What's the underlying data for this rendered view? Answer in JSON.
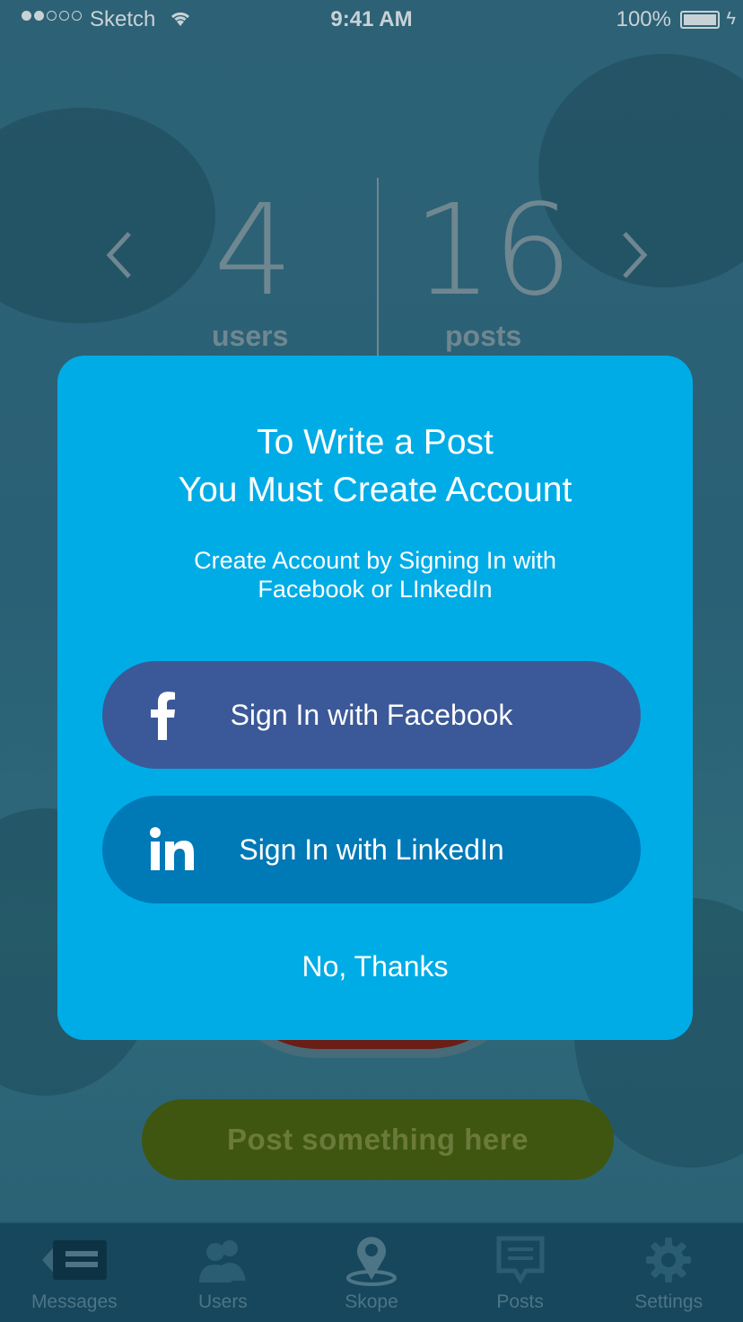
{
  "status_bar": {
    "carrier": "Sketch",
    "time": "9:41 AM",
    "battery": "100%"
  },
  "stats": {
    "users_count": "4",
    "users_label": "users",
    "posts_count": "16",
    "posts_label": "posts"
  },
  "post_prompt": "Post something here",
  "modal": {
    "title_line1": "To Write a Post",
    "title_line2": "You Must Create Account",
    "subtitle_line1": "Create Account by Signing In with",
    "subtitle_line2": "Facebook or LInkedIn",
    "facebook_button": "Sign In with Facebook",
    "linkedin_button": "Sign In with LinkedIn",
    "dismiss": "No, Thanks"
  },
  "tabs": [
    {
      "label": "Messages",
      "icon": "messages-icon"
    },
    {
      "label": "Users",
      "icon": "users-icon"
    },
    {
      "label": "Skope",
      "icon": "location-pin-icon"
    },
    {
      "label": "Posts",
      "icon": "posts-icon"
    },
    {
      "label": "Settings",
      "icon": "gear-icon"
    }
  ],
  "colors": {
    "modal_bg": "#00ace6",
    "facebook": "#3b5998",
    "linkedin": "#0079b7",
    "post_pill": "#3f5610"
  }
}
